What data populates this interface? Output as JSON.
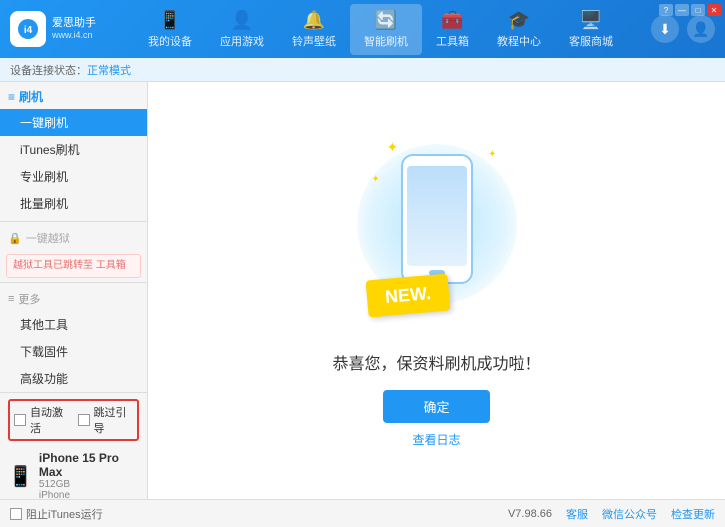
{
  "app": {
    "title": "爱思助手",
    "subtitle": "www.i4.cn"
  },
  "win_controls": {
    "minimize": "—",
    "maximize": "□",
    "close": "✕"
  },
  "nav": {
    "tabs": [
      {
        "id": "my-device",
        "label": "我的设备",
        "icon": "📱"
      },
      {
        "id": "apps-games",
        "label": "应用游戏",
        "icon": "👤"
      },
      {
        "id": "ringtones",
        "label": "铃声壁纸",
        "icon": "🔔"
      },
      {
        "id": "smart-flash",
        "label": "智能刷机",
        "icon": "🔄",
        "active": true
      },
      {
        "id": "toolbox",
        "label": "工具箱",
        "icon": "🧰"
      },
      {
        "id": "tutorial",
        "label": "教程中心",
        "icon": "🎓"
      },
      {
        "id": "store",
        "label": "客服商城",
        "icon": "🖥️"
      }
    ],
    "download_icon": "⬇",
    "user_icon": "👤"
  },
  "breadcrumb": {
    "prefix": "设备连接状态：",
    "status": "正常模式"
  },
  "sidebar": {
    "flash_section": {
      "icon": "📱",
      "label": "刷机"
    },
    "items": [
      {
        "id": "one-key-flash",
        "label": "一键刷机",
        "active": true
      },
      {
        "id": "itunes-flash",
        "label": "iTunes刷机"
      },
      {
        "id": "pro-flash",
        "label": "专业刷机"
      },
      {
        "id": "batch-flash",
        "label": "批量刷机"
      }
    ],
    "disabled_section": {
      "icon": "🔒",
      "label": "一键越狱"
    },
    "disabled_notice": "越狱工具已跳转至\n工具箱",
    "more_section": "更多",
    "more_items": [
      {
        "id": "other-tools",
        "label": "其他工具"
      },
      {
        "id": "download-firmware",
        "label": "下载固件"
      },
      {
        "id": "advanced",
        "label": "高级功能"
      }
    ],
    "auto_activate": "自动激活",
    "guided_activate": "跳过引导",
    "device": {
      "name": "iPhone 15 Pro Max",
      "storage": "512GB",
      "type": "iPhone"
    }
  },
  "content": {
    "new_badge": "NEW.",
    "success_message": "恭喜您，保资料刷机成功啦！",
    "confirm_button": "确定",
    "log_link": "查看日志"
  },
  "footer": {
    "no_itunes": "阻止iTunes运行",
    "version": "V7.98.66",
    "links": [
      "客服",
      "微信公众号",
      "检查更新"
    ]
  }
}
